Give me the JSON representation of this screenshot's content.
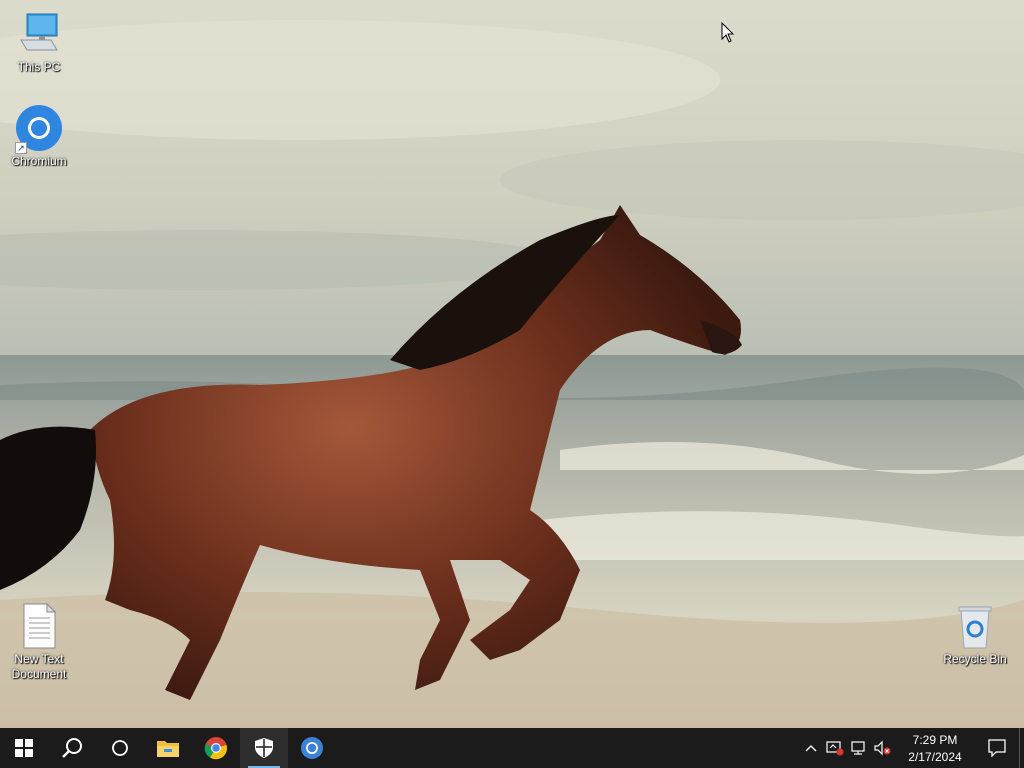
{
  "desktop": {
    "icons": [
      {
        "label": "This PC",
        "icon": "computer-icon"
      },
      {
        "label": "Chromium",
        "icon": "chromium-icon"
      },
      {
        "label": "New Text\nDocument",
        "icon": "text-document-icon"
      },
      {
        "label": "Recycle Bin",
        "icon": "recycle-bin-icon"
      }
    ],
    "wallpaper": "horse running on beach"
  },
  "taskbar": {
    "buttons": [
      {
        "icon": "windows-start-icon"
      },
      {
        "icon": "search-icon"
      },
      {
        "icon": "task-view-icon"
      },
      {
        "icon": "file-explorer-icon"
      },
      {
        "icon": "chrome-icon"
      },
      {
        "icon": "windows-security-icon",
        "active": true
      },
      {
        "icon": "chromium-icon"
      }
    ],
    "tray": {
      "icons": [
        "chevron-up-icon",
        "security-alert-icon",
        "network-icon",
        "volume-muted-icon"
      ],
      "time": "7:29 PM",
      "date": "2/17/2024"
    }
  },
  "colors": {
    "taskbar": "#1b1b1b",
    "accent": "#76b9ed"
  }
}
